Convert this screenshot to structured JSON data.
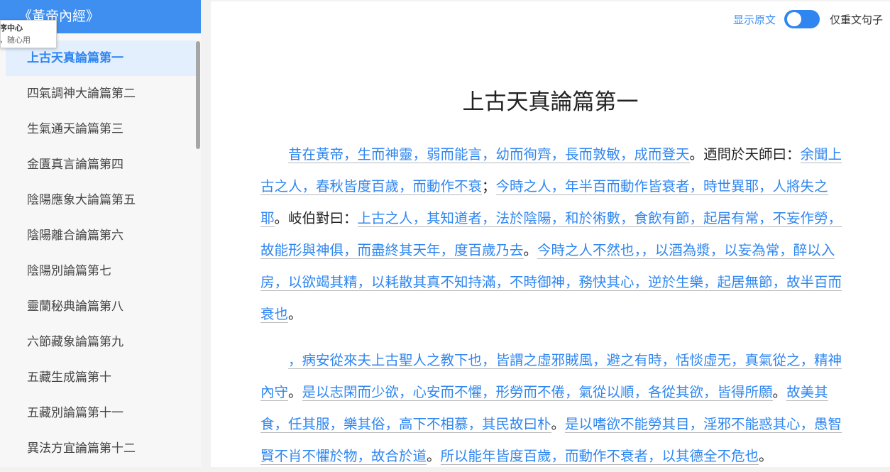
{
  "sidebar": {
    "book_title": "《黃帝內經》",
    "chapters": [
      "上古天真論篇第一",
      "四氣調神大論篇第二",
      "生氣通天論篇第三",
      "金匱真言論篇第四",
      "陰陽應象大論篇第五",
      "陰陽離合論篇第六",
      "陰陽別論篇第七",
      "靈蘭秘典論篇第八",
      "六節藏象論篇第九",
      "五藏生成篇第十",
      "五藏別論篇第十一",
      "異法方宜論篇第十二"
    ],
    "active_index": 0
  },
  "tooltip": {
    "line1": "程序中心",
    "line2": "，随心用"
  },
  "toolbar": {
    "show_original_label": "显示原文",
    "toggle_on": true,
    "only_sentences_label": "仅重文句子"
  },
  "content": {
    "title": "上古天真論篇第一",
    "paragraphs": [
      [
        {
          "t": "昔在黃帝，生而神靈，弱而能言，幼而徇齊，長而敦敏，成而登天",
          "h": true
        },
        {
          "t": "。迺問於天師曰：",
          "h": false
        },
        {
          "t": "余聞上古之人，春秋皆度百歲，而動作不衰",
          "h": true
        },
        {
          "t": "；",
          "h": false
        },
        {
          "t": "今時之人，年半百而動作皆衰者，時世異耶，人將失之耶",
          "h": true
        },
        {
          "t": "。岐伯對曰：",
          "h": false
        },
        {
          "t": "上古之人，其知道者，法於陰陽，和於術數，食飲有節，起居有常，不妄作勞，故能形與神俱，而盡終其天年，度百歲乃去",
          "h": true
        },
        {
          "t": "。",
          "h": false
        },
        {
          "t": "今時之人不然也，，以酒為漿，以妄為常，醉以入房，以欲竭其精，以耗散其真不知持滿，不時御神，務快其心，逆於生樂，起居無節，故半百而衰也",
          "h": true
        },
        {
          "t": "。",
          "h": false
        }
      ],
      [
        {
          "t": "，病安從來夫上古聖人之教下也，皆謂之虛邪賊風，避之有時，恬惔虛无，真氣從之，精神內守",
          "h": true
        },
        {
          "t": "。",
          "h": false
        },
        {
          "t": "是以志閑而少欲，心安而不懼，形勞而不倦，氣從以順，各從其欲，皆得所願",
          "h": true
        },
        {
          "t": "。",
          "h": false
        },
        {
          "t": "故美其食，任其服，樂其俗，高下不相慕，其民故曰朴",
          "h": true
        },
        {
          "t": "。",
          "h": false
        },
        {
          "t": "是以嗜欲不能勞其目，淫邪不能惑其心，愚智賢不肖不懼於物，故合於道",
          "h": true
        },
        {
          "t": "。",
          "h": false
        },
        {
          "t": "所以能年皆度百歲，而動作不衰者，以其德全不危也",
          "h": true
        },
        {
          "t": "。",
          "h": false
        }
      ]
    ]
  }
}
